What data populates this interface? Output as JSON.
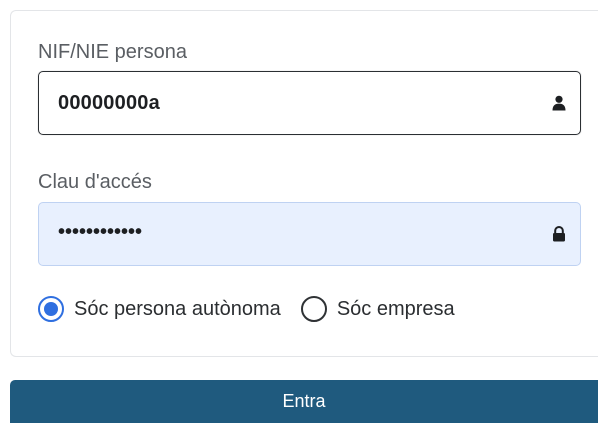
{
  "login_form": {
    "nif_label": "NIF/NIE persona",
    "nif_value": "00000000a",
    "nif_icon": "user-icon",
    "password_label": "Clau d'accés",
    "password_value": "••••••••••••",
    "password_icon": "lock-icon",
    "user_type": {
      "selected": "Sóc persona autònoma",
      "options": [
        {
          "label": "Sóc persona autònoma",
          "checked": true
        },
        {
          "label": "Sóc empresa",
          "checked": false
        }
      ]
    },
    "submit_label": "Entra"
  },
  "colors": {
    "accent": "#2f6fe0",
    "button_bg": "#1f5a7e",
    "autofill_bg": "#e8f0fe"
  }
}
